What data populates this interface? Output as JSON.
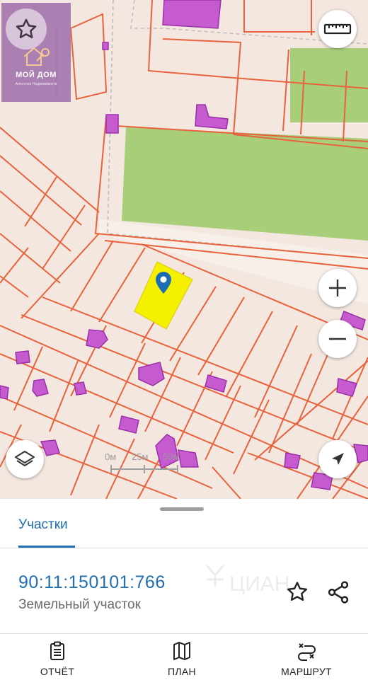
{
  "map": {
    "logo": {
      "brand": "МОЙ ДОМ",
      "subtitle": "Агентство Недвижимости"
    },
    "scale": {
      "labels": [
        "0м",
        "25м",
        "50м"
      ]
    },
    "controls": {
      "favorites_icon": "star-icon",
      "ruler_icon": "ruler-icon",
      "zoom_in_icon": "plus-icon",
      "zoom_out_icon": "minus-icon",
      "layers_icon": "layers-icon",
      "locate_icon": "navigation-arrow-icon"
    },
    "colors": {
      "parcel_border": "#e8623c",
      "building": "#c65bd0",
      "highlight": "#f5f000",
      "marker": "#1b6db4",
      "green": "#a7cf7a"
    }
  },
  "sheet": {
    "tab_label": "Участки",
    "cadastral_number": "90:11:150101:766",
    "object_type": "Земельный участок",
    "watermark": "ЦИАН"
  },
  "bottom_nav": [
    {
      "label": "ОТЧЁТ",
      "icon": "report-icon"
    },
    {
      "label": "ПЛАН",
      "icon": "map-plan-icon"
    },
    {
      "label": "МАРШРУТ",
      "icon": "route-icon"
    }
  ],
  "accent": "#1f6fb2"
}
